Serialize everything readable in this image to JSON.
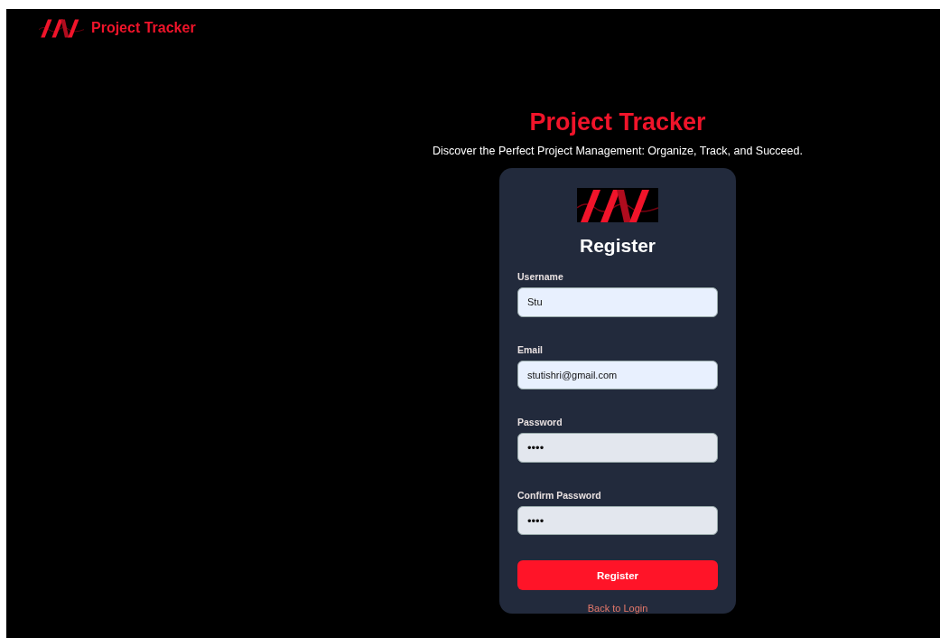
{
  "header": {
    "brand": "Project Tracker"
  },
  "hero": {
    "title": "Project Tracker",
    "subtitle": "Discover the Perfect Project Management: Organize, Track, and Succeed."
  },
  "form": {
    "title": "Register",
    "fields": [
      {
        "label": "Username",
        "value": "Stu",
        "autofilled": true
      },
      {
        "label": "Email",
        "value": "stutishri@gmail.com",
        "autofilled": true
      },
      {
        "label": "Password",
        "value": "••••",
        "autofilled": false
      },
      {
        "label": "Confirm Password",
        "value": "••••",
        "autofilled": false
      }
    ],
    "submit": "Register",
    "link": "Back to Login"
  }
}
